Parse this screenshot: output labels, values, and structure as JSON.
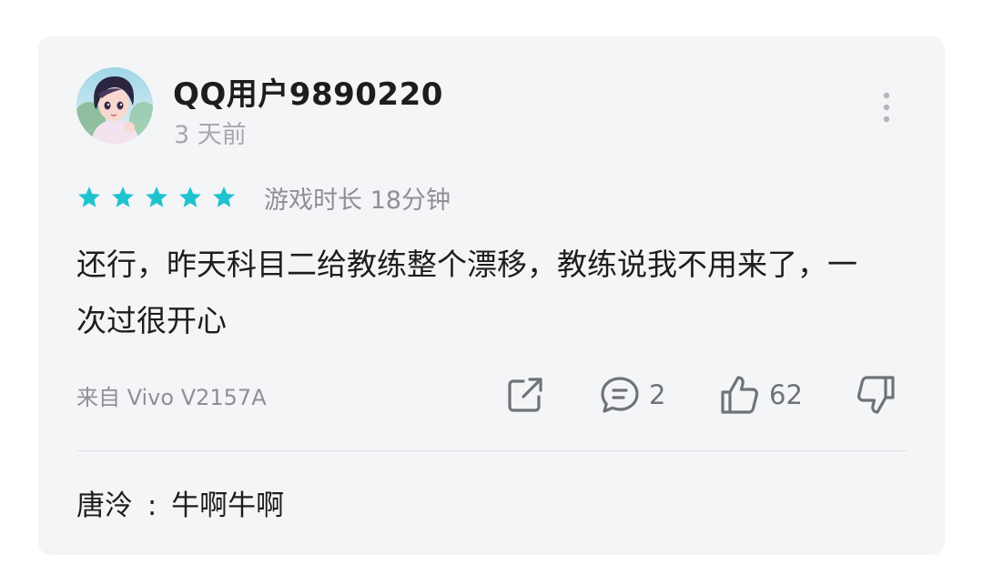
{
  "review": {
    "username": "QQ用户9890220",
    "time_ago": "3 天前",
    "rating": 5,
    "rating_max": 5,
    "playtime": "游戏时长 18分钟",
    "text": "还行，昨天科目二给教练整个漂移，教练说我不用来了，一次过很开心",
    "device": "来自 Vivo V2157A",
    "comment_count": "2",
    "like_count": "62"
  },
  "reply": {
    "author": "唐泠",
    "separator": ":",
    "text": "牛啊牛啊"
  },
  "colors": {
    "star": "#1fc3d0",
    "card_bg": "#f4f5f7",
    "icon": "#6f7277"
  },
  "icons": {
    "more": "more-vertical-icon",
    "share": "share-icon",
    "comment": "comment-icon",
    "like": "thumbs-up-icon",
    "dislike": "thumbs-down-icon",
    "star": "star-icon"
  }
}
